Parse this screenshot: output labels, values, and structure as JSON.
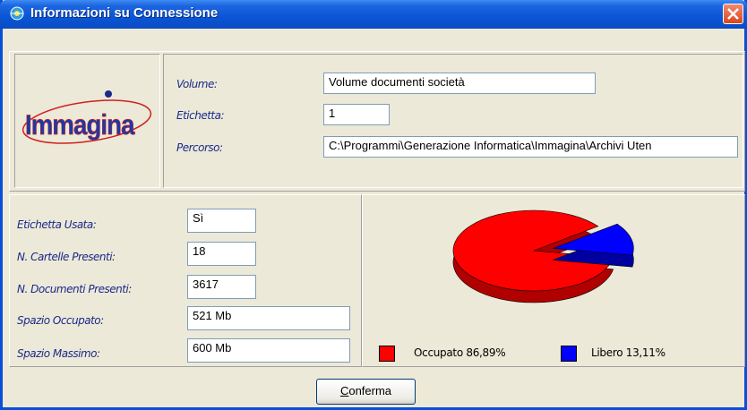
{
  "window": {
    "title": "Informazioni su Connessione"
  },
  "logo": {
    "text": "Immagina"
  },
  "volume_info": {
    "volume_label": "Volume:",
    "volume_value": "Volume documenti società",
    "etichetta_label": "Etichetta:",
    "etichetta_value": "1",
    "percorso_label": "Percorso:",
    "percorso_value": "C:\\Programmi\\Generazione Informatica\\Immagina\\Archivi Uten"
  },
  "stats": {
    "etichetta_usata_label": "Etichetta Usata:",
    "etichetta_usata_value": "Sì",
    "cartelle_label": "N. Cartelle Presenti:",
    "cartelle_value": "18",
    "documenti_label": "N. Documenti Presenti:",
    "documenti_value": "3617",
    "occupato_label": "Spazio Occupato:",
    "occupato_value": "521 Mb",
    "massimo_label": "Spazio Massimo:",
    "massimo_value": "600 Mb"
  },
  "chart_data": {
    "type": "pie",
    "categories": [
      "Occupato",
      "Libero"
    ],
    "values": [
      86.89,
      13.11
    ],
    "colors": [
      "#ff0000",
      "#0000ff"
    ],
    "legend": [
      "Occupato 86,89%",
      "Libero 13,11%"
    ]
  },
  "buttons": {
    "confirm_label_first": "C",
    "confirm_label_rest": "onferma"
  },
  "colors": {
    "titlebar": "#0a55d4",
    "window_bg": "#ece9d8",
    "label_text": "#1a2a8a"
  }
}
